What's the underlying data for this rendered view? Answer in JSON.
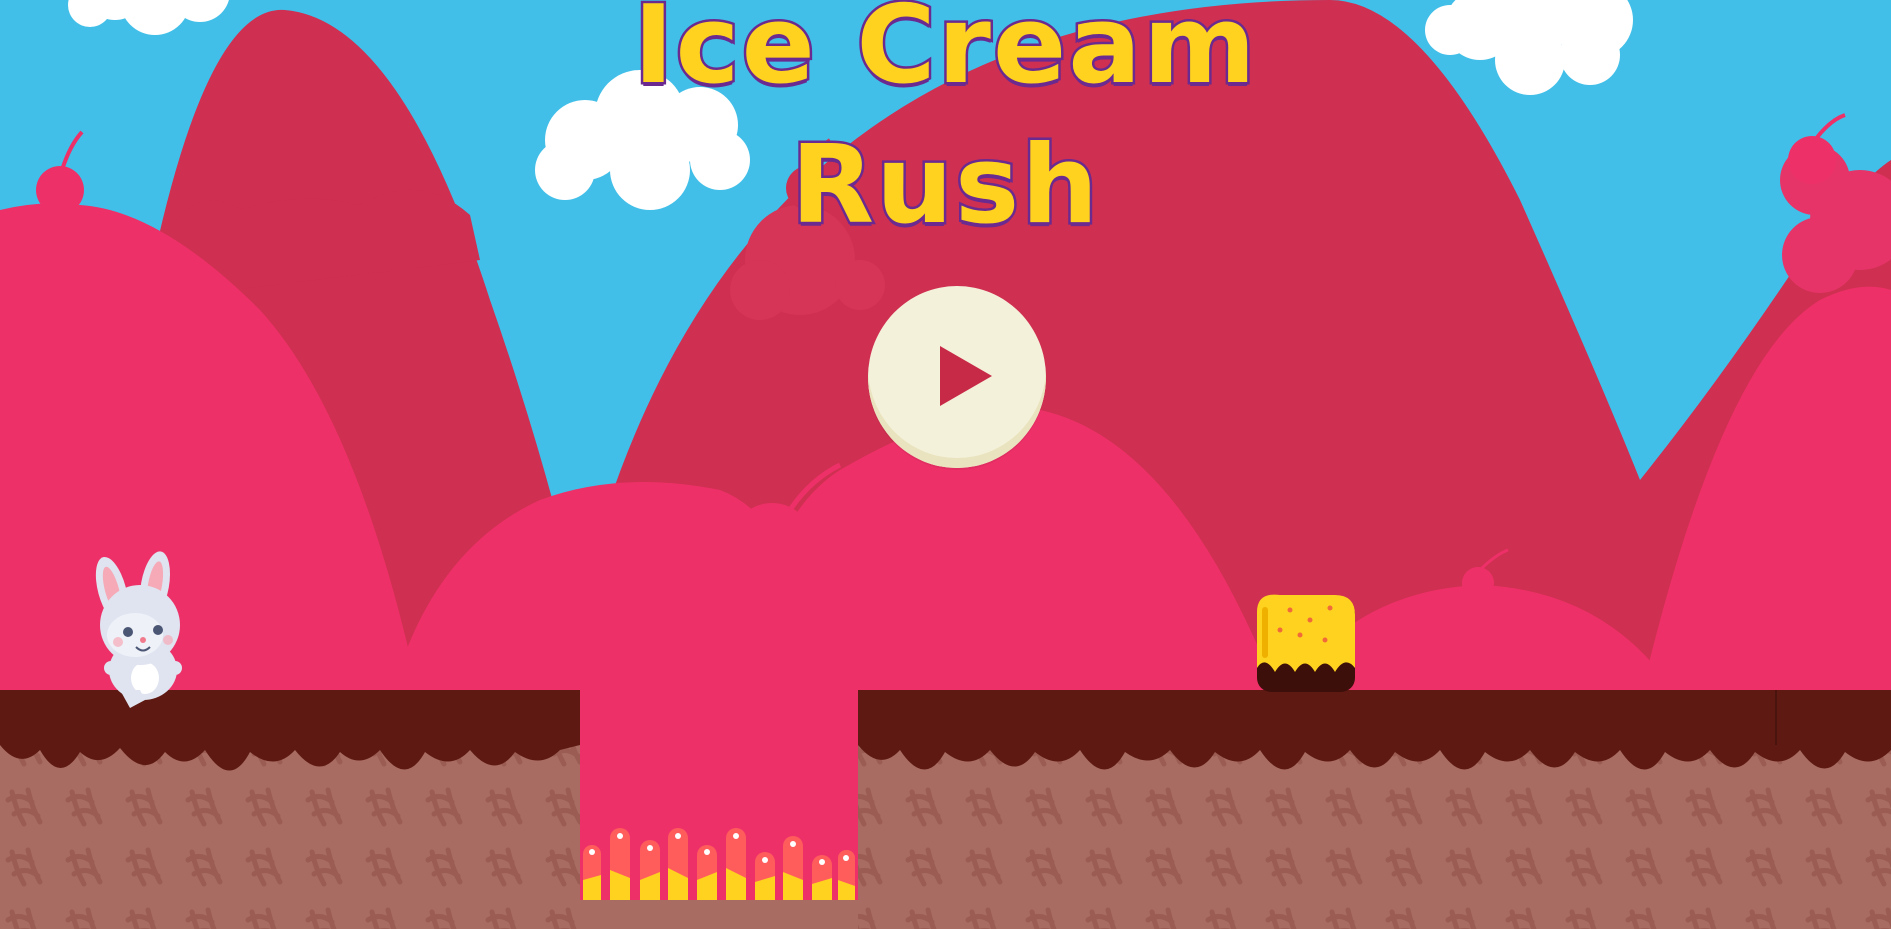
{
  "game": {
    "title_line1": "Ice Cream",
    "title_line2": "Rush",
    "play_button_icon": "play-icon"
  },
  "colors": {
    "sky": "#41bfe8",
    "hill_dark": "#cf2f51",
    "hill_pink": "#ee3068",
    "chocolate": "#5e1a12",
    "cone": "#a86c62",
    "title_fill": "#ffd21f",
    "title_stroke": "#6a2a8f",
    "play_button": "#f4f1da",
    "play_icon": "#c72a47"
  }
}
